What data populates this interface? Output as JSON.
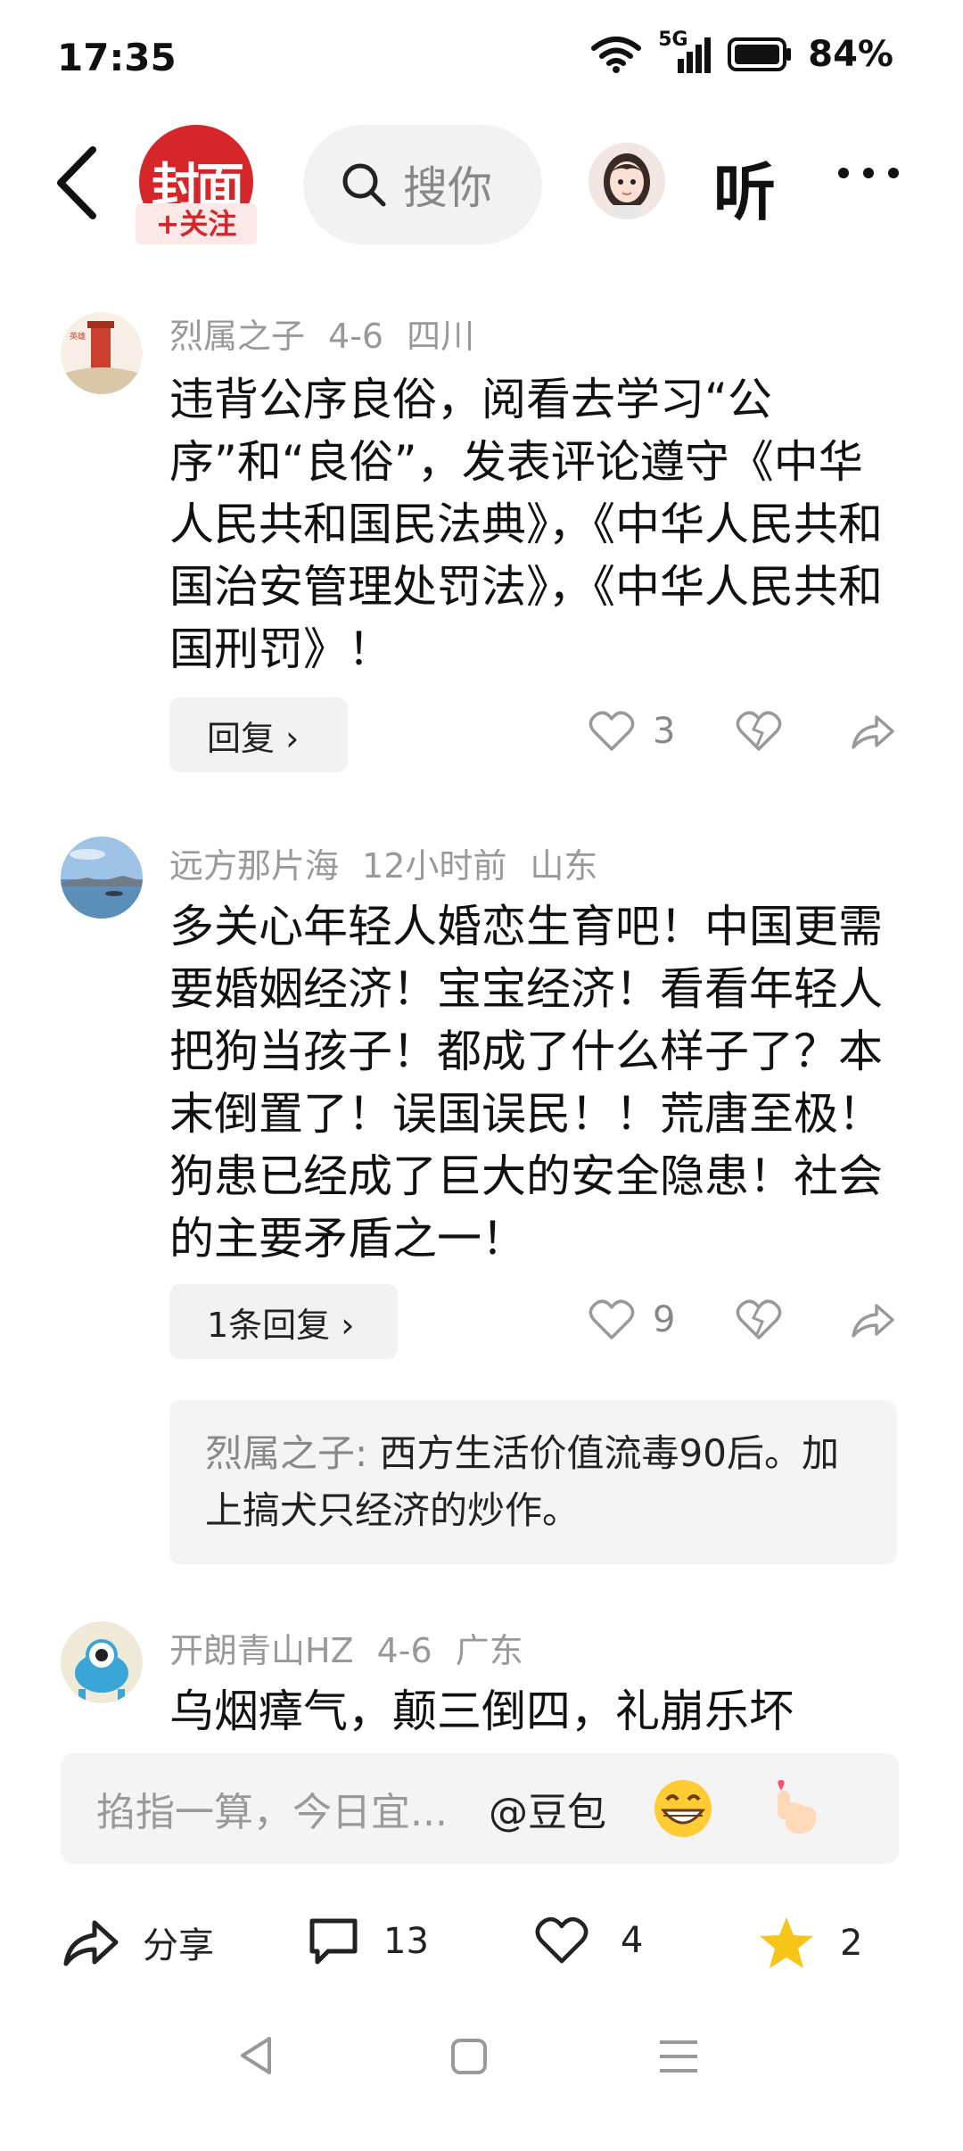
{
  "status_bar": {
    "time": "17:35",
    "network": "5G",
    "battery": "84%"
  },
  "header": {
    "logo_text": "封面",
    "follow_label": "+关注",
    "search_placeholder": "搜你",
    "listen_label": "听"
  },
  "comments": [
    {
      "author": "烈属之子",
      "date": "4-6",
      "location": "四川",
      "text": "违背公序良俗，阅看去学习“公序”和“良俗”，发表评论遵守《中华人民共和国民法典》，《中华人民共和国治安管理处罚法》，《中华人民共和国刑罚》！",
      "reply_label": "回复 ›",
      "likes": "3"
    },
    {
      "author": "远方那片海",
      "date": "12小时前",
      "location": "山东",
      "text": "多关心年轻人婚恋生育吧！中国更需要婚姻经济！宝宝经济！看看年轻人把狗当孩子！都成了什么样子了？本末倒置了！误国误民！！荒唐至极！狗患已经成了巨大的安全隐患！社会的主要矛盾之一！",
      "reply_label": "1条回复 ›",
      "likes": "9",
      "sub_reply": {
        "author": "烈属之子:",
        "text": " 西方生活价值流毒90后。加上搞犬只经济的炒作。"
      }
    },
    {
      "author": "开朗青山HZ",
      "date": "4-6",
      "location": "广东",
      "text": "乌烟瘴气，颠三倒四，礼崩乐坏"
    }
  ],
  "composer": {
    "placeholder": "掐指一算，今日宜...",
    "doubao": "@豆包"
  },
  "bottom_bar": {
    "share_label": "分享",
    "comments_count": "13",
    "likes_count": "4",
    "favorites_count": "2"
  },
  "colors": {
    "brand_red": "#d5262a",
    "star_yellow": "#f5c518"
  }
}
